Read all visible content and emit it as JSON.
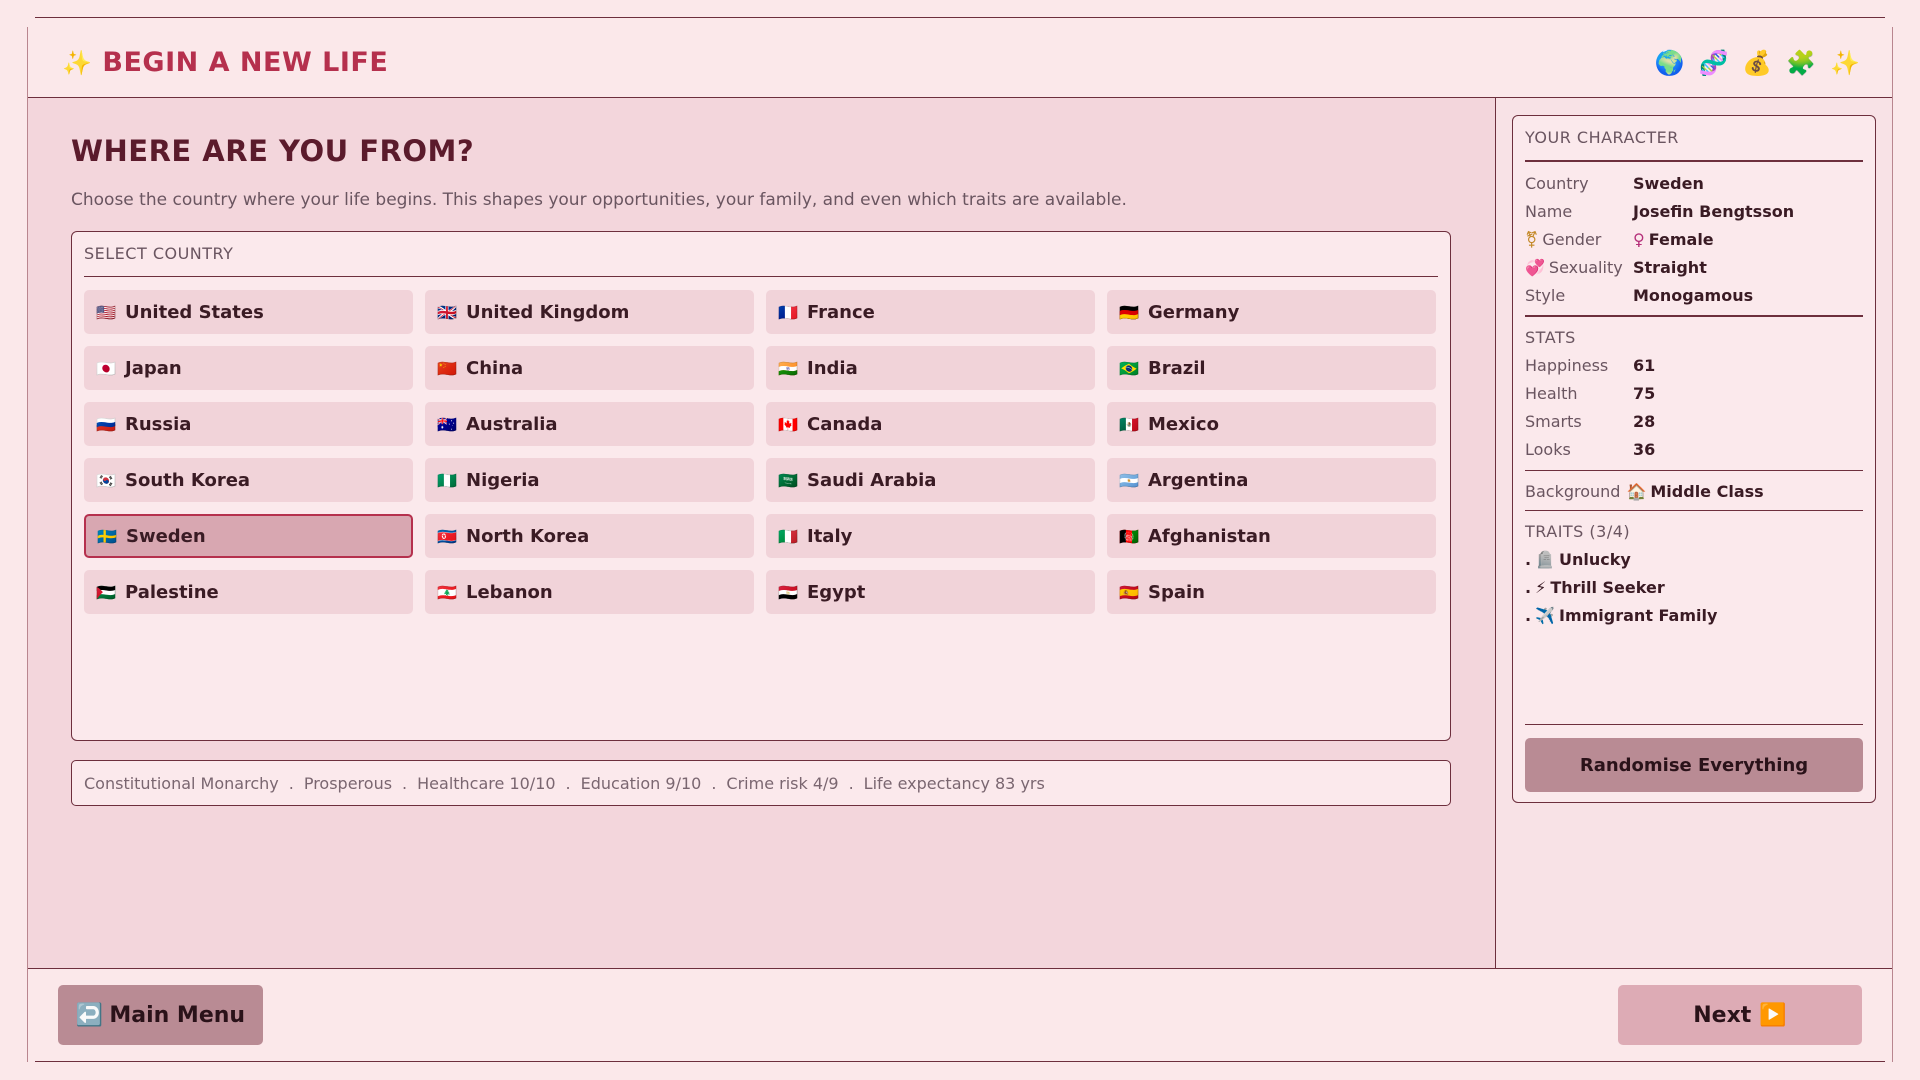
{
  "header": {
    "title": "BEGIN A NEW LIFE",
    "title_icon": "✨",
    "icons": [
      {
        "name": "globe-icon",
        "glyph": "🌍"
      },
      {
        "name": "dna-icon",
        "glyph": "🧬"
      },
      {
        "name": "money-bag-icon",
        "glyph": "💰"
      },
      {
        "name": "puzzle-icon",
        "glyph": "🧩"
      },
      {
        "name": "sparkles-icon",
        "glyph": "✨"
      }
    ]
  },
  "main": {
    "heading": "WHERE ARE YOU FROM?",
    "intro": "Choose the country where your life begins. This shapes your opportunities, your family, and even which traits are available.",
    "select_label": "SELECT COUNTRY",
    "selected_country": "Sweden",
    "countries": [
      {
        "name": "United States",
        "flag": "🇺🇸"
      },
      {
        "name": "United Kingdom",
        "flag": "🇬🇧"
      },
      {
        "name": "France",
        "flag": "🇫🇷"
      },
      {
        "name": "Germany",
        "flag": "🇩🇪"
      },
      {
        "name": "Japan",
        "flag": "🇯🇵"
      },
      {
        "name": "China",
        "flag": "🇨🇳"
      },
      {
        "name": "India",
        "flag": "🇮🇳"
      },
      {
        "name": "Brazil",
        "flag": "🇧🇷"
      },
      {
        "name": "Russia",
        "flag": "🇷🇺"
      },
      {
        "name": "Australia",
        "flag": "🇦🇺"
      },
      {
        "name": "Canada",
        "flag": "🇨🇦"
      },
      {
        "name": "Mexico",
        "flag": "🇲🇽"
      },
      {
        "name": "South Korea",
        "flag": "🇰🇷"
      },
      {
        "name": "Nigeria",
        "flag": "🇳🇬"
      },
      {
        "name": "Saudi Arabia",
        "flag": "🇸🇦"
      },
      {
        "name": "Argentina",
        "flag": "🇦🇷"
      },
      {
        "name": "Sweden",
        "flag": "🇸🇪"
      },
      {
        "name": "North Korea",
        "flag": "🇰🇵"
      },
      {
        "name": "Italy",
        "flag": "🇮🇹"
      },
      {
        "name": "Afghanistan",
        "flag": "🇦🇫"
      },
      {
        "name": "Palestine",
        "flag": "🇵🇸"
      },
      {
        "name": "Lebanon",
        "flag": "🇱🇧"
      },
      {
        "name": "Egypt",
        "flag": "🇪🇬"
      },
      {
        "name": "Spain",
        "flag": "🇪🇸"
      }
    ],
    "info": [
      "Constitutional Monarchy",
      "Prosperous",
      "Healthcare 10/10",
      "Education 9/10",
      "Crime risk 4/9",
      "Life expectancy 83 yrs"
    ],
    "info_separator": "."
  },
  "character": {
    "title": "YOUR CHARACTER",
    "country_label": "Country",
    "country": "Sweden",
    "name_label": "Name",
    "name": "Josefin Bengtsson",
    "gender_label": "Gender",
    "gender_icon": "⚧",
    "gender_value_icon": "♀",
    "gender": "Female",
    "sexuality_label": "Sexuality",
    "sexuality_icon": "💞",
    "sexuality": "Straight",
    "style_label": "Style",
    "style": "Monogamous",
    "stats_title": "STATS",
    "stats": [
      {
        "label": "Happiness",
        "value": "61"
      },
      {
        "label": "Health",
        "value": "75"
      },
      {
        "label": "Smarts",
        "value": "28"
      },
      {
        "label": "Looks",
        "value": "36"
      }
    ],
    "background_label": "Background",
    "background_icon": "🏠",
    "background": "Middle Class",
    "traits_title": "TRAITS (3/4)",
    "traits": [
      {
        "icon": "🪦",
        "label": "Unlucky"
      },
      {
        "icon": "⚡",
        "label": "Thrill Seeker"
      },
      {
        "icon": "✈️",
        "label": "Immigrant Family"
      }
    ],
    "trait_bullet": ".",
    "randomise_label": "Randomise Everything"
  },
  "footer": {
    "menu_icon": "↩️",
    "menu_label": "Main Menu",
    "next_label": "Next",
    "next_icon": "▶️"
  }
}
